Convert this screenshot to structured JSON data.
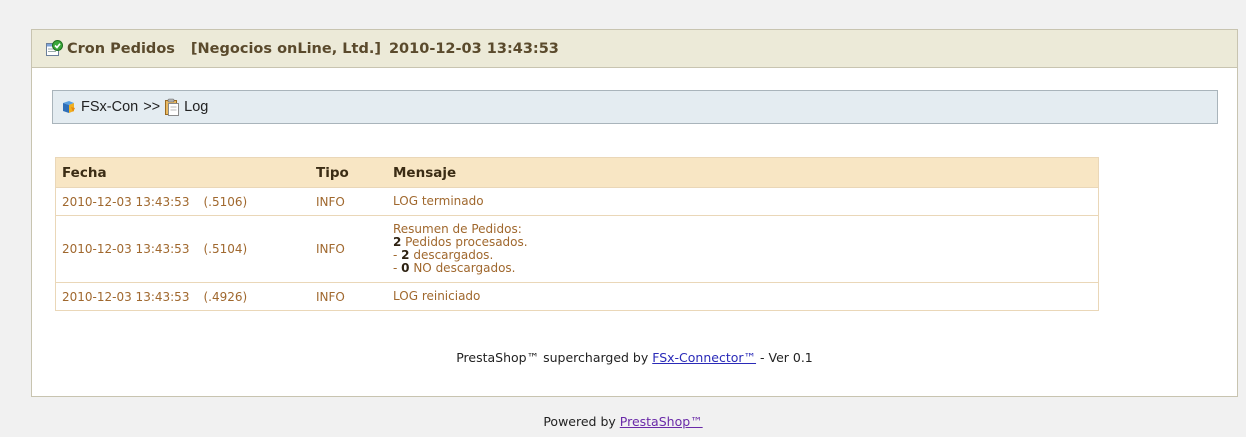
{
  "header": {
    "title": "Cron Pedidos",
    "company": "[Negocios onLine, Ltd.]",
    "datetime": "2010-12-03 13:43:53",
    "icon": "cron-task-icon"
  },
  "breadcrumb": {
    "root": "FSx-Con",
    "separator": ">>",
    "current": "Log",
    "root_icon": "fsx-connector-icon",
    "current_icon": "clipboard-icon"
  },
  "log_table": {
    "columns": [
      "Fecha",
      "Tipo",
      "Mensaje"
    ],
    "rows": [
      {
        "date": "2010-12-03 13:43:53",
        "seq": "(.5106)",
        "type": "INFO",
        "message": "LOG terminado"
      },
      {
        "date": "2010-12-03 13:43:53",
        "seq": "(.5104)",
        "type": "INFO",
        "message_lines": [
          {
            "pre": "Resumen de Pedidos:",
            "bold": "",
            "post": ""
          },
          {
            "pre": "",
            "bold": "2",
            "post": " Pedidos procesados."
          },
          {
            "pre": "- ",
            "bold": "2",
            "post": " descargados."
          },
          {
            "pre": "- ",
            "bold": "0",
            "post": " NO descargados."
          }
        ]
      },
      {
        "date": "2010-12-03 13:43:53",
        "seq": "(.4926)",
        "type": "INFO",
        "message": "LOG reiniciado"
      }
    ]
  },
  "footer": {
    "line1_prefix": "PrestaShop™ supercharged by ",
    "line1_link": "FSx-Connector™",
    "line1_suffix": " - Ver 0.1",
    "line2_prefix": "Powered by ",
    "line2_link": "PrestaShop™"
  },
  "colors": {
    "header_bg": "#ecead8",
    "breadcrumb_bg": "#e4ecf1",
    "table_header_bg": "#f8e6c4",
    "row_text": "#a0682e"
  }
}
